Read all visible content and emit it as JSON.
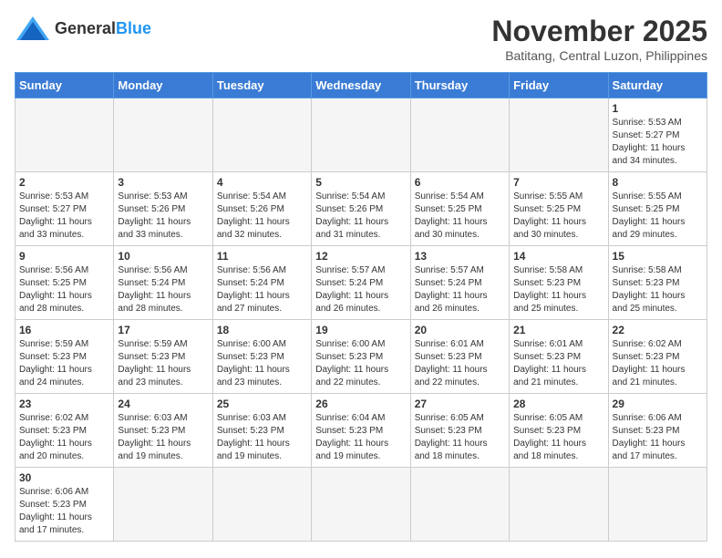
{
  "header": {
    "logo_general": "General",
    "logo_blue": "Blue",
    "month_title": "November 2025",
    "subtitle": "Batitang, Central Luzon, Philippines"
  },
  "weekdays": [
    "Sunday",
    "Monday",
    "Tuesday",
    "Wednesday",
    "Thursday",
    "Friday",
    "Saturday"
  ],
  "weeks": [
    [
      {
        "day": "",
        "info": ""
      },
      {
        "day": "",
        "info": ""
      },
      {
        "day": "",
        "info": ""
      },
      {
        "day": "",
        "info": ""
      },
      {
        "day": "",
        "info": ""
      },
      {
        "day": "",
        "info": ""
      },
      {
        "day": "1",
        "info": "Sunrise: 5:53 AM\nSunset: 5:27 PM\nDaylight: 11 hours\nand 34 minutes."
      }
    ],
    [
      {
        "day": "2",
        "info": "Sunrise: 5:53 AM\nSunset: 5:27 PM\nDaylight: 11 hours\nand 33 minutes."
      },
      {
        "day": "3",
        "info": "Sunrise: 5:53 AM\nSunset: 5:26 PM\nDaylight: 11 hours\nand 33 minutes."
      },
      {
        "day": "4",
        "info": "Sunrise: 5:54 AM\nSunset: 5:26 PM\nDaylight: 11 hours\nand 32 minutes."
      },
      {
        "day": "5",
        "info": "Sunrise: 5:54 AM\nSunset: 5:26 PM\nDaylight: 11 hours\nand 31 minutes."
      },
      {
        "day": "6",
        "info": "Sunrise: 5:54 AM\nSunset: 5:25 PM\nDaylight: 11 hours\nand 30 minutes."
      },
      {
        "day": "7",
        "info": "Sunrise: 5:55 AM\nSunset: 5:25 PM\nDaylight: 11 hours\nand 30 minutes."
      },
      {
        "day": "8",
        "info": "Sunrise: 5:55 AM\nSunset: 5:25 PM\nDaylight: 11 hours\nand 29 minutes."
      }
    ],
    [
      {
        "day": "9",
        "info": "Sunrise: 5:56 AM\nSunset: 5:25 PM\nDaylight: 11 hours\nand 28 minutes."
      },
      {
        "day": "10",
        "info": "Sunrise: 5:56 AM\nSunset: 5:24 PM\nDaylight: 11 hours\nand 28 minutes."
      },
      {
        "day": "11",
        "info": "Sunrise: 5:56 AM\nSunset: 5:24 PM\nDaylight: 11 hours\nand 27 minutes."
      },
      {
        "day": "12",
        "info": "Sunrise: 5:57 AM\nSunset: 5:24 PM\nDaylight: 11 hours\nand 26 minutes."
      },
      {
        "day": "13",
        "info": "Sunrise: 5:57 AM\nSunset: 5:24 PM\nDaylight: 11 hours\nand 26 minutes."
      },
      {
        "day": "14",
        "info": "Sunrise: 5:58 AM\nSunset: 5:23 PM\nDaylight: 11 hours\nand 25 minutes."
      },
      {
        "day": "15",
        "info": "Sunrise: 5:58 AM\nSunset: 5:23 PM\nDaylight: 11 hours\nand 25 minutes."
      }
    ],
    [
      {
        "day": "16",
        "info": "Sunrise: 5:59 AM\nSunset: 5:23 PM\nDaylight: 11 hours\nand 24 minutes."
      },
      {
        "day": "17",
        "info": "Sunrise: 5:59 AM\nSunset: 5:23 PM\nDaylight: 11 hours\nand 23 minutes."
      },
      {
        "day": "18",
        "info": "Sunrise: 6:00 AM\nSunset: 5:23 PM\nDaylight: 11 hours\nand 23 minutes."
      },
      {
        "day": "19",
        "info": "Sunrise: 6:00 AM\nSunset: 5:23 PM\nDaylight: 11 hours\nand 22 minutes."
      },
      {
        "day": "20",
        "info": "Sunrise: 6:01 AM\nSunset: 5:23 PM\nDaylight: 11 hours\nand 22 minutes."
      },
      {
        "day": "21",
        "info": "Sunrise: 6:01 AM\nSunset: 5:23 PM\nDaylight: 11 hours\nand 21 minutes."
      },
      {
        "day": "22",
        "info": "Sunrise: 6:02 AM\nSunset: 5:23 PM\nDaylight: 11 hours\nand 21 minutes."
      }
    ],
    [
      {
        "day": "23",
        "info": "Sunrise: 6:02 AM\nSunset: 5:23 PM\nDaylight: 11 hours\nand 20 minutes."
      },
      {
        "day": "24",
        "info": "Sunrise: 6:03 AM\nSunset: 5:23 PM\nDaylight: 11 hours\nand 19 minutes."
      },
      {
        "day": "25",
        "info": "Sunrise: 6:03 AM\nSunset: 5:23 PM\nDaylight: 11 hours\nand 19 minutes."
      },
      {
        "day": "26",
        "info": "Sunrise: 6:04 AM\nSunset: 5:23 PM\nDaylight: 11 hours\nand 19 minutes."
      },
      {
        "day": "27",
        "info": "Sunrise: 6:05 AM\nSunset: 5:23 PM\nDaylight: 11 hours\nand 18 minutes."
      },
      {
        "day": "28",
        "info": "Sunrise: 6:05 AM\nSunset: 5:23 PM\nDaylight: 11 hours\nand 18 minutes."
      },
      {
        "day": "29",
        "info": "Sunrise: 6:06 AM\nSunset: 5:23 PM\nDaylight: 11 hours\nand 17 minutes."
      }
    ],
    [
      {
        "day": "30",
        "info": "Sunrise: 6:06 AM\nSunset: 5:23 PM\nDaylight: 11 hours\nand 17 minutes."
      },
      {
        "day": "",
        "info": ""
      },
      {
        "day": "",
        "info": ""
      },
      {
        "day": "",
        "info": ""
      },
      {
        "day": "",
        "info": ""
      },
      {
        "day": "",
        "info": ""
      },
      {
        "day": "",
        "info": ""
      }
    ]
  ]
}
